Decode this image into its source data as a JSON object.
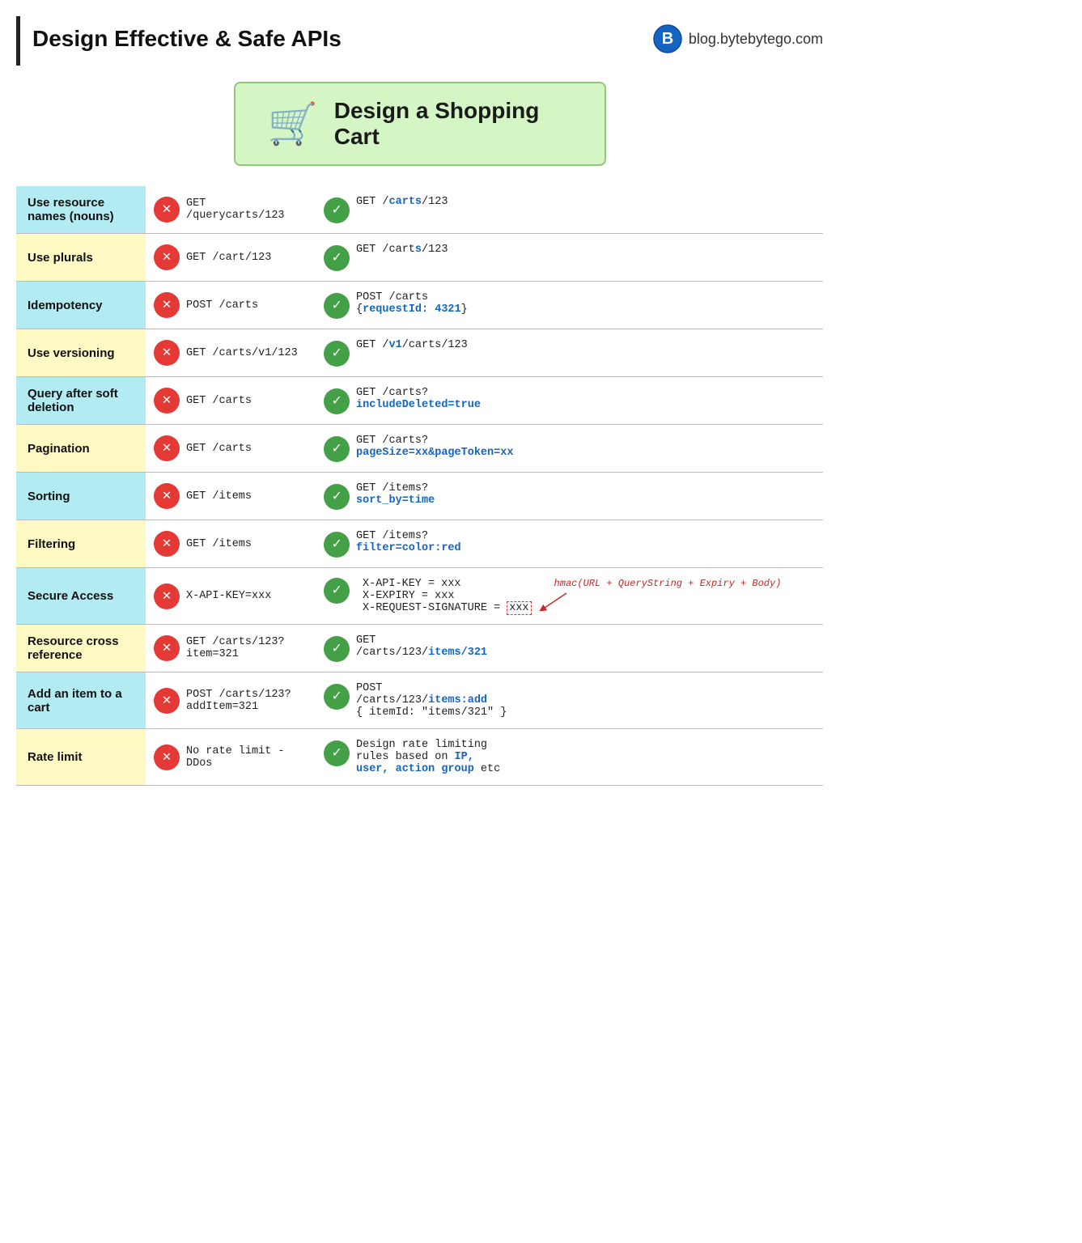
{
  "header": {
    "title": "Design Effective & Safe APIs",
    "logo_text": "blog.bytebytego.com"
  },
  "hero": {
    "title": "Design a Shopping Cart"
  },
  "rows": [
    {
      "id": "use-resource-names",
      "label": "Use resource names (nouns)",
      "color": "cyan",
      "bad": "GET /querycarts/123",
      "good_lines": [
        "GET /carts/123"
      ],
      "good_highlights": [
        {
          "text": "carts",
          "color": "blue"
        }
      ]
    },
    {
      "id": "use-plurals",
      "label": "Use plurals",
      "color": "yellow",
      "bad": "GET /cart/123",
      "good_lines": [
        "GET /carts/123"
      ],
      "good_highlights": [
        {
          "text": "s",
          "color": "blue"
        }
      ]
    },
    {
      "id": "idempotency",
      "label": "Idempotency",
      "color": "cyan",
      "bad": "POST /carts",
      "good_lines": [
        "POST /carts",
        "{requestId: 4321}"
      ],
      "good_highlights": [
        {
          "text": "requestId: 4321",
          "color": "blue"
        }
      ]
    },
    {
      "id": "use-versioning",
      "label": "Use versioning",
      "color": "yellow",
      "bad": "GET /carts/v1/123",
      "good_lines": [
        "GET /v1/carts/123"
      ],
      "good_highlights": [
        {
          "text": "v1",
          "color": "blue"
        }
      ]
    },
    {
      "id": "query-soft-deletion",
      "label": "Query after soft deletion",
      "color": "cyan",
      "bad": "GET /carts",
      "good_lines": [
        "GET /carts?",
        "includeDeleted=true"
      ],
      "good_highlights": [
        {
          "text": "includeDeleted=true",
          "color": "blue"
        }
      ]
    },
    {
      "id": "pagination",
      "label": "Pagination",
      "color": "yellow",
      "bad": "GET /carts",
      "good_lines": [
        "GET /carts?",
        "pageSize=xx&pageToken=xx"
      ],
      "good_highlights": [
        {
          "text": "pageSize=xx&pageToken=xx",
          "color": "blue"
        }
      ]
    },
    {
      "id": "sorting",
      "label": "Sorting",
      "color": "cyan",
      "bad": "GET /items",
      "good_lines": [
        "GET /items?",
        "sort_by=time"
      ],
      "good_highlights": [
        {
          "text": "sort_by=time",
          "color": "blue"
        }
      ]
    },
    {
      "id": "filtering",
      "label": "Filtering",
      "color": "yellow",
      "bad": "GET /items",
      "good_lines": [
        "GET /items?",
        "filter=color:red"
      ],
      "good_highlights": [
        {
          "text": "filter=color:red",
          "color": "blue"
        }
      ]
    },
    {
      "id": "secure-access",
      "label": "Secure Access",
      "color": "cyan",
      "bad": "X-API-KEY=xxx",
      "good_lines": [
        "X-API-KEY = xxx",
        "X-EXPIRY = xxx",
        "X-REQUEST-SIGNATURE = xxx"
      ],
      "good_highlights": [
        {
          "text": "xxx",
          "color": "dashed"
        }
      ],
      "hmac": "hmac(URL + QueryString + Expiry + Body)"
    },
    {
      "id": "resource-cross-reference",
      "label": "Resource cross reference",
      "color": "yellow",
      "bad": "GET /carts/123?\nitem=321",
      "good_lines": [
        "GET",
        "/carts/123/items/321"
      ],
      "good_highlights": [
        {
          "text": "items/321",
          "color": "blue"
        }
      ]
    },
    {
      "id": "add-item-to-cart",
      "label": "Add an item to a cart",
      "color": "cyan",
      "bad": "POST /carts/123?\naddItem=321",
      "good_lines": [
        "POST",
        "/carts/123/items:add",
        "{ itemId: \"items/321\" }"
      ],
      "good_highlights": [
        {
          "text": "items:add",
          "color": "blue"
        }
      ]
    },
    {
      "id": "rate-limit",
      "label": "Rate limit",
      "color": "yellow",
      "bad": "No rate limit -\nDDos",
      "good_lines": [
        "Design rate limiting",
        "rules based on IP,",
        "user, action group etc"
      ],
      "good_highlights": [
        {
          "text": "IP,",
          "color": "blue"
        },
        {
          "text": "user, action group",
          "color": "blue"
        }
      ]
    }
  ]
}
